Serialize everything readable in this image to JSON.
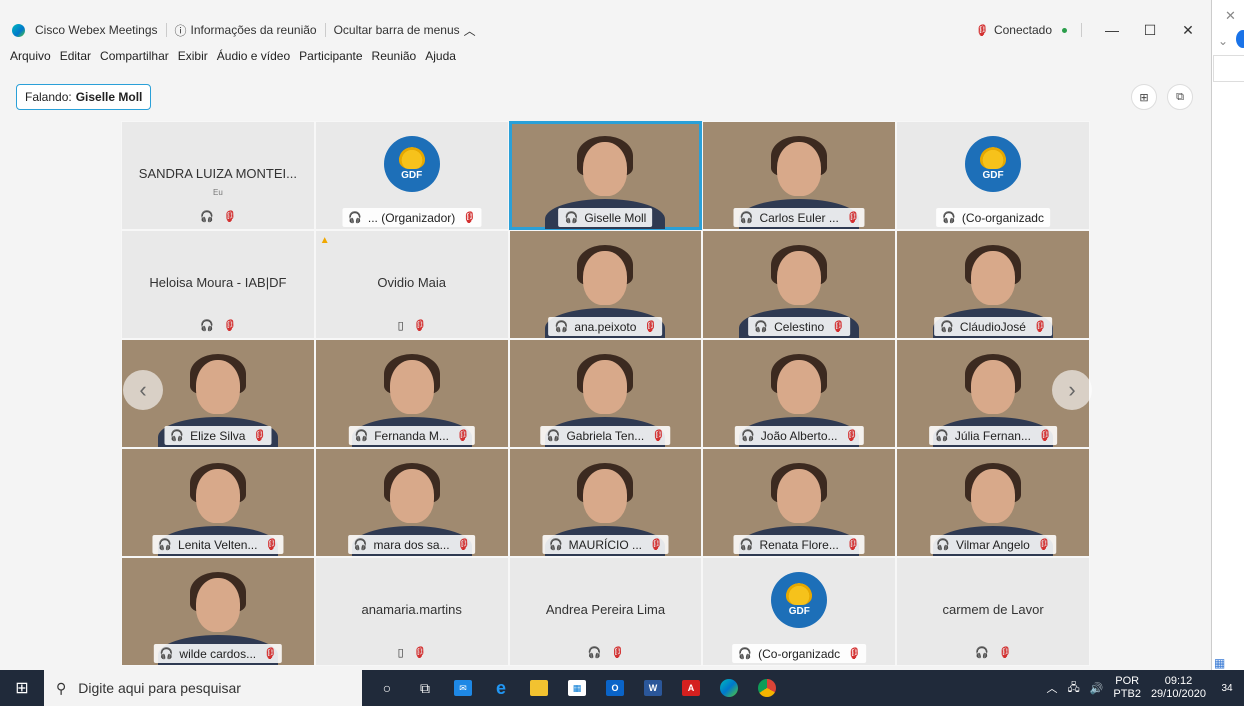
{
  "titlebar": {
    "app_name": "Cisco Webex Meetings",
    "meeting_info": "Informações da reunião",
    "hide_menu": "Ocultar barra de menus",
    "status": "Conectado",
    "minimize": "—",
    "maximize": "☐",
    "close": "✕"
  },
  "menubar": [
    "Arquivo",
    "Editar",
    "Compartilhar",
    "Exibir",
    "Áudio e vídeo",
    "Participante",
    "Reunião",
    "Ajuda"
  ],
  "speaking": {
    "prefix": "Falando:",
    "name": "Giselle Moll"
  },
  "tiles": [
    {
      "name": "SANDRA LUIZA MONTEI...",
      "sub": "Eu",
      "type": "text"
    },
    {
      "name": "... (Organizador)",
      "type": "gdf"
    },
    {
      "name": "Giselle Moll",
      "type": "video",
      "active": true
    },
    {
      "name": "Carlos Euler ...",
      "type": "video"
    },
    {
      "name": "(Co-organizadc",
      "type": "gdf"
    },
    {
      "name": "Heloisa Moura - IAB|DF",
      "type": "text"
    },
    {
      "name": "Ovidio Maia",
      "type": "text",
      "warn": true
    },
    {
      "name": "ana.peixoto",
      "type": "video"
    },
    {
      "name": "Celestino",
      "type": "video"
    },
    {
      "name": "CláudioJosé",
      "type": "video"
    },
    {
      "name": "Elize Silva",
      "type": "video"
    },
    {
      "name": "Fernanda M...",
      "type": "video"
    },
    {
      "name": "Gabriela Ten...",
      "type": "video"
    },
    {
      "name": "João Alberto...",
      "type": "video"
    },
    {
      "name": "Júlia Fernan...",
      "type": "video"
    },
    {
      "name": "Lenita Velten...",
      "type": "video"
    },
    {
      "name": "mara dos sa...",
      "type": "video"
    },
    {
      "name": "MAURÍCIO ...",
      "type": "video"
    },
    {
      "name": "Renata Flore...",
      "type": "video"
    },
    {
      "name": "Vilmar Angelo",
      "type": "video"
    },
    {
      "name": "wilde cardos...",
      "type": "video"
    },
    {
      "name": "anamaria.martins",
      "type": "text"
    },
    {
      "name": "Andrea Pereira Lima",
      "type": "text"
    },
    {
      "name": "(Co-organizadc",
      "type": "gdf"
    },
    {
      "name": "carmem de Lavor",
      "type": "text"
    }
  ],
  "gdf_logo_text": "GDF",
  "taskbar": {
    "search_placeholder": "Digite aqui para pesquisar",
    "lang_top": "POR",
    "lang_bottom": "PTB2",
    "time": "09:12",
    "date": "29/10/2020",
    "notifications": "34"
  }
}
